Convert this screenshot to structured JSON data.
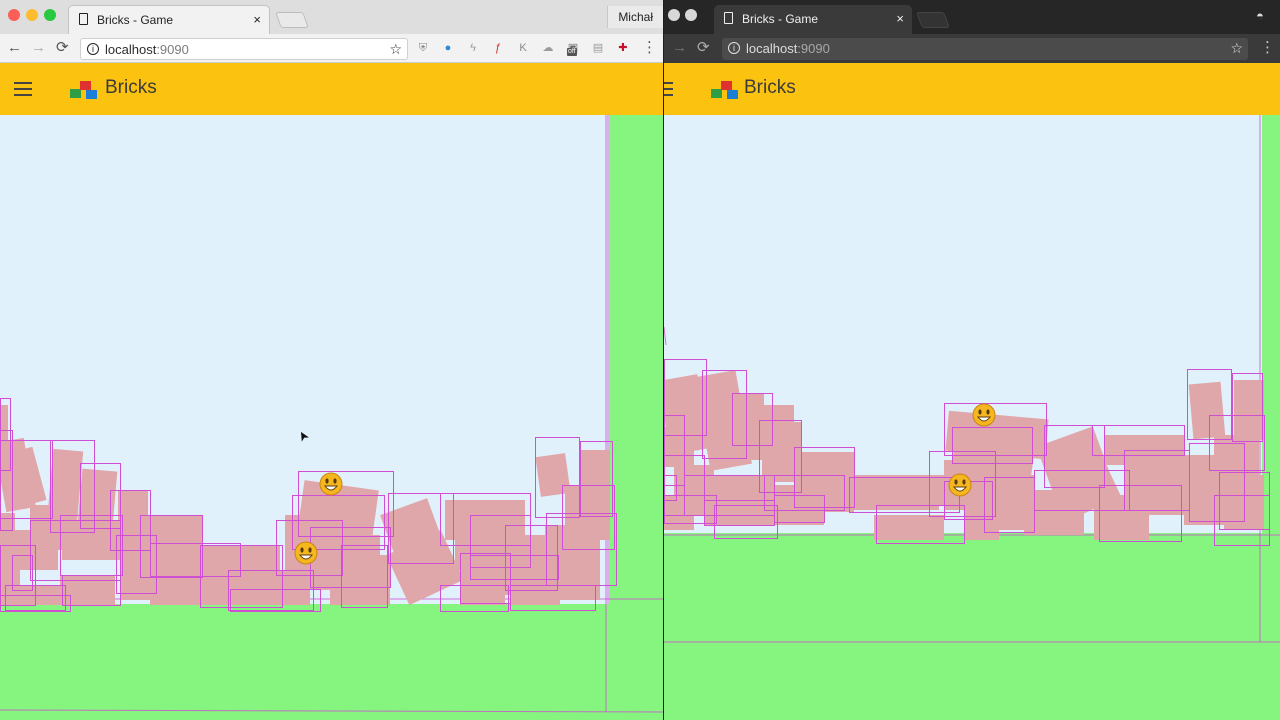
{
  "windowA": {
    "tab": {
      "title": "Bricks - Game",
      "close": "×"
    },
    "profile": "Michał",
    "nav": {
      "back": "←",
      "forward": "→",
      "reload": "⟳"
    },
    "address": {
      "host": "localhost",
      "port": ":9090",
      "info": "i",
      "star": "☆"
    },
    "extensions": [
      {
        "name": "shield-extension-icon",
        "glyph": "⛨",
        "color": "#8a8a8a"
      },
      {
        "name": "globe-extension-icon",
        "glyph": "●",
        "color": "#2f87d6"
      },
      {
        "name": "bolt-extension-icon",
        "glyph": "ϟ",
        "color": "#9a9a9a"
      },
      {
        "name": "f-extension-icon",
        "glyph": "ƒ",
        "color": "#d0302a"
      },
      {
        "name": "k-extension-icon",
        "glyph": "K",
        "color": "#8b8b8b"
      },
      {
        "name": "cloud-extension-icon",
        "glyph": "☁",
        "color": "#9a9a9a"
      },
      {
        "name": "off-extension-icon",
        "glyph": "▣",
        "color": "#666"
      },
      {
        "name": "chart-extension-icon",
        "glyph": "▤",
        "color": "#9a9a9a"
      },
      {
        "name": "uk-flag-extension-icon",
        "glyph": "✚",
        "color": "#c8102e"
      }
    ],
    "off_badge": "off",
    "menu": "⋮",
    "app": {
      "title": "Bricks"
    }
  },
  "windowB": {
    "tab": {
      "title": "Bricks - Game",
      "close": "×"
    },
    "incognito": "◓",
    "nav": {
      "back": "←",
      "forward": "→",
      "reload": "⟳"
    },
    "address": {
      "host": "localhost",
      "port": ":9090",
      "info": "i",
      "star": "☆"
    },
    "menu": "⋮",
    "app": {
      "title": "Bricks"
    }
  },
  "smileys": {
    "glyph": "☺"
  },
  "colors": {
    "appbar": "#fbc20f",
    "sky": "#e1f1fc",
    "ground": "#86f57f",
    "brick": "#e0a7ab",
    "outline": "#cf4fd4",
    "traffic": [
      "#fc5f57",
      "#fdbc2e",
      "#28c840"
    ]
  },
  "pointer": {
    "glyph": "➤"
  }
}
